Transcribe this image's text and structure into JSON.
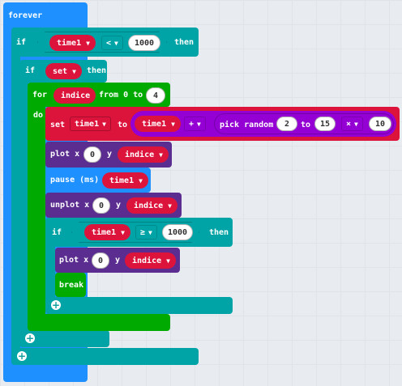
{
  "colors": {
    "loops": "#1e90ff",
    "logic": "#00a4a6",
    "for": "#00aa00",
    "variables": "#dc143c",
    "led": "#5c2d91",
    "math": "#9400d3",
    "basic": "#1e90ff"
  },
  "forever": {
    "label": "forever"
  },
  "if1": {
    "if_label": "if",
    "var": "time1",
    "op": "<",
    "value": "1000",
    "then_label": "then"
  },
  "if2": {
    "if_label": "if",
    "cond": "set",
    "then_label": "then"
  },
  "for_loop": {
    "for_label": "for",
    "var": "indice",
    "from_label": "from 0 to",
    "to": "4",
    "do_label": "do"
  },
  "set_stmt": {
    "set_label": "set",
    "var": "time1",
    "to_label": "to",
    "left": "time1",
    "op": "+",
    "random_label": "pick random",
    "min": "2",
    "to2_label": "to",
    "max": "15",
    "mul_op": "×",
    "factor": "10"
  },
  "plot1": {
    "label": "plot x",
    "x": "0",
    "y_label": "y",
    "y": "indice"
  },
  "pause": {
    "label": "pause (ms)",
    "value": "time1"
  },
  "unplot": {
    "label": "unplot x",
    "x": "0",
    "y_label": "y",
    "y": "indice"
  },
  "if3": {
    "if_label": "if",
    "var": "time1",
    "op": "≥",
    "value": "1000",
    "then_label": "then"
  },
  "plot2": {
    "label": "plot x",
    "x": "0",
    "y_label": "y",
    "y": "indice"
  },
  "brk": {
    "label": "break"
  },
  "icons": {
    "plus": "plus-circle-icon",
    "caret": "caret-down-icon"
  }
}
